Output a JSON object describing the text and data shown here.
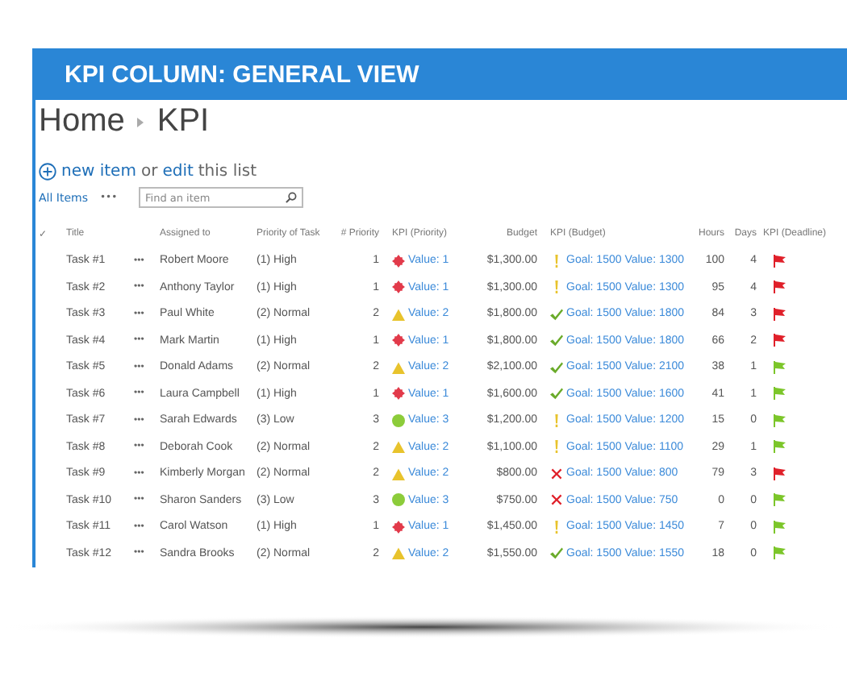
{
  "banner": {
    "title": "KPI COLUMN: GENERAL VIEW"
  },
  "breadcrumb": [
    "Home",
    "KPI"
  ],
  "actions": {
    "new_item": "new item",
    "or": "or",
    "edit": "edit",
    "this_list": "this list"
  },
  "view": {
    "label": "All Items",
    "more": "•••",
    "search_placeholder": "Find an item"
  },
  "table": {
    "columns": [
      "✓",
      "Title",
      "Assigned to",
      "Priority of Task",
      "# Priority",
      "KPI (Priority)",
      "Budget",
      "KPI (Budget)",
      "Hours",
      "Days",
      "KPI (Deadline)"
    ],
    "rows": [
      {
        "title": "Task #1",
        "more": "•••",
        "assigned": "Robert Moore",
        "priority": "(1) High",
        "num": "1",
        "kpi_priority": {
          "kind": "diamond",
          "text": "Value: 1"
        },
        "budget": "$1,300.00",
        "kpi_budget": {
          "kind": "warning",
          "text": "Goal: 1500 Value: 1300"
        },
        "hours": "100",
        "days": "4",
        "deadline": {
          "color": "#e0202a"
        }
      },
      {
        "title": "Task #2",
        "more": "•••",
        "assigned": "Anthony Taylor",
        "priority": "(1) High",
        "num": "1",
        "kpi_priority": {
          "kind": "diamond",
          "text": "Value: 1"
        },
        "budget": "$1,300.00",
        "kpi_budget": {
          "kind": "warning",
          "text": "Goal: 1500 Value: 1300"
        },
        "hours": "95",
        "days": "4",
        "deadline": {
          "color": "#e0202a"
        }
      },
      {
        "title": "Task #3",
        "more": "•••",
        "assigned": "Paul White",
        "priority": "(2) Normal",
        "num": "2",
        "kpi_priority": {
          "kind": "triangle",
          "text": "Value: 2"
        },
        "budget": "$1,800.00",
        "kpi_budget": {
          "kind": "ok",
          "text": "Goal: 1500 Value: 1800"
        },
        "hours": "84",
        "days": "3",
        "deadline": {
          "color": "#e0202a"
        }
      },
      {
        "title": "Task #4",
        "more": "•••",
        "assigned": "Mark Martin",
        "priority": "(1) High",
        "num": "1",
        "kpi_priority": {
          "kind": "diamond",
          "text": "Value: 1"
        },
        "budget": "$1,800.00",
        "kpi_budget": {
          "kind": "ok",
          "text": "Goal: 1500 Value: 1800"
        },
        "hours": "66",
        "days": "2",
        "deadline": {
          "color": "#e0202a"
        }
      },
      {
        "title": "Task #5",
        "more": "•••",
        "assigned": "Donald Adams",
        "priority": "(2) Normal",
        "num": "2",
        "kpi_priority": {
          "kind": "triangle",
          "text": "Value: 2"
        },
        "budget": "$2,100.00",
        "kpi_budget": {
          "kind": "ok",
          "text": "Goal: 1500 Value: 2100"
        },
        "hours": "38",
        "days": "1",
        "deadline": {
          "color": "#7cc62a"
        }
      },
      {
        "title": "Task #6",
        "more": "•••",
        "assigned": "Laura Campbell",
        "priority": "(1) High",
        "num": "1",
        "kpi_priority": {
          "kind": "diamond",
          "text": "Value: 1"
        },
        "budget": "$1,600.00",
        "kpi_budget": {
          "kind": "ok",
          "text": "Goal: 1500 Value: 1600"
        },
        "hours": "41",
        "days": "1",
        "deadline": {
          "color": "#7cc62a"
        }
      },
      {
        "title": "Task #7",
        "more": "•••",
        "assigned": "Sarah Edwards",
        "priority": "(3) Low",
        "num": "3",
        "kpi_priority": {
          "kind": "circle",
          "text": "Value: 3"
        },
        "budget": "$1,200.00",
        "kpi_budget": {
          "kind": "warning",
          "text": "Goal: 1500 Value: 1200"
        },
        "hours": "15",
        "days": "0",
        "deadline": {
          "color": "#7cc62a"
        }
      },
      {
        "title": "Task #8",
        "more": "•••",
        "assigned": "Deborah Cook",
        "priority": "(2) Normal",
        "num": "2",
        "kpi_priority": {
          "kind": "triangle",
          "text": "Value: 2"
        },
        "budget": "$1,100.00",
        "kpi_budget": {
          "kind": "warning",
          "text": "Goal: 1500 Value: 1100"
        },
        "hours": "29",
        "days": "1",
        "deadline": {
          "color": "#7cc62a"
        }
      },
      {
        "title": "Task #9",
        "more": "•••",
        "assigned": "Kimberly Morgan",
        "priority": "(2) Normal",
        "num": "2",
        "kpi_priority": {
          "kind": "triangle",
          "text": "Value: 2"
        },
        "budget": "$800.00",
        "kpi_budget": {
          "kind": "over",
          "text": "Goal: 1500 Value: 800"
        },
        "hours": "79",
        "days": "3",
        "deadline": {
          "color": "#e0202a"
        }
      },
      {
        "title": "Task #10",
        "more": "•••",
        "assigned": "Sharon Sanders",
        "priority": "(3) Low",
        "num": "3",
        "kpi_priority": {
          "kind": "circle",
          "text": "Value: 3"
        },
        "budget": "$750.00",
        "kpi_budget": {
          "kind": "over",
          "text": "Goal: 1500 Value: 750"
        },
        "hours": "0",
        "days": "0",
        "deadline": {
          "color": "#7cc62a"
        }
      },
      {
        "title": "Task #11",
        "more": "•••",
        "assigned": "Carol Watson",
        "priority": "(1) High",
        "num": "1",
        "kpi_priority": {
          "kind": "diamond",
          "text": "Value: 1"
        },
        "budget": "$1,450.00",
        "kpi_budget": {
          "kind": "warning",
          "text": "Goal: 1500 Value: 1450"
        },
        "hours": "7",
        "days": "0",
        "deadline": {
          "color": "#7cc62a"
        }
      },
      {
        "title": "Task #12",
        "more": "•••",
        "assigned": "Sandra Brooks",
        "priority": "(2) Normal",
        "num": "2",
        "kpi_priority": {
          "kind": "triangle",
          "text": "Value: 2"
        },
        "budget": "$1,550.00",
        "kpi_budget": {
          "kind": "ok",
          "text": "Goal: 1500 Value: 1550"
        },
        "hours": "18",
        "days": "0",
        "deadline": {
          "color": "#7cc62a"
        }
      }
    ]
  }
}
